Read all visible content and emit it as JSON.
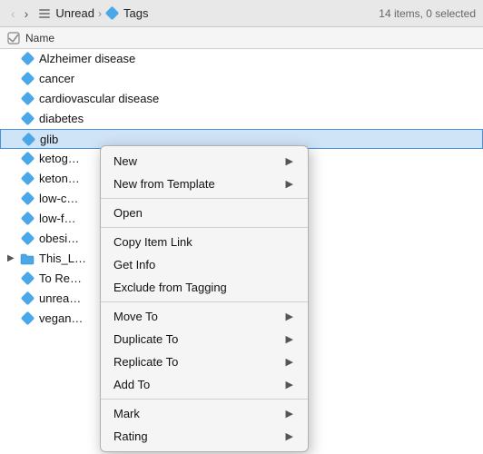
{
  "toolbar": {
    "back_label": "‹",
    "forward_label": "›",
    "breadcrumb": [
      {
        "id": "unread",
        "text": "Unread",
        "icon": "stack"
      },
      {
        "id": "tags",
        "text": "Tags",
        "icon": "tag"
      }
    ],
    "item_count": "14 items, 0 selected"
  },
  "column_header": {
    "name_label": "Name"
  },
  "files": [
    {
      "id": "alzheimer",
      "name": "Alzheimer disease",
      "icon": "tag",
      "indent": 0,
      "expand": false
    },
    {
      "id": "cancer",
      "name": "cancer",
      "icon": "tag",
      "indent": 0,
      "expand": false
    },
    {
      "id": "cardiovascular",
      "name": "cardiovascular disease",
      "icon": "tag",
      "indent": 0,
      "expand": false
    },
    {
      "id": "diabetes",
      "name": "diabetes",
      "icon": "tag",
      "indent": 0,
      "expand": false
    },
    {
      "id": "glib",
      "name": "glib",
      "icon": "tag",
      "indent": 0,
      "expand": false,
      "selected": true
    },
    {
      "id": "ketog",
      "name": "ketog…",
      "icon": "tag",
      "indent": 0,
      "expand": false
    },
    {
      "id": "keton",
      "name": "keton…",
      "icon": "tag",
      "indent": 0,
      "expand": false
    },
    {
      "id": "low-c",
      "name": "low-c…",
      "icon": "tag",
      "indent": 0,
      "expand": false
    },
    {
      "id": "low-f",
      "name": "low-f…",
      "icon": "tag",
      "indent": 0,
      "expand": false
    },
    {
      "id": "obesi",
      "name": "obesi…",
      "icon": "tag",
      "indent": 0,
      "expand": false
    },
    {
      "id": "this_l",
      "name": "This_L…",
      "icon": "folder",
      "indent": 0,
      "expand": true
    },
    {
      "id": "to-re",
      "name": "To Re…",
      "icon": "tag",
      "indent": 0,
      "expand": false
    },
    {
      "id": "unrea",
      "name": "unrea…",
      "icon": "tag",
      "indent": 0,
      "expand": false
    },
    {
      "id": "vegan",
      "name": "vegan…",
      "icon": "tag",
      "indent": 0,
      "expand": false
    }
  ],
  "context_menu": {
    "items": [
      {
        "id": "new",
        "label": "New",
        "has_submenu": true
      },
      {
        "id": "new-from-template",
        "label": "New from Template",
        "has_submenu": true
      },
      {
        "id": "sep1",
        "type": "separator"
      },
      {
        "id": "open",
        "label": "Open",
        "has_submenu": false
      },
      {
        "id": "sep2",
        "type": "separator"
      },
      {
        "id": "copy-item-link",
        "label": "Copy Item Link",
        "has_submenu": false
      },
      {
        "id": "get-info",
        "label": "Get Info",
        "has_submenu": false
      },
      {
        "id": "exclude-from-tagging",
        "label": "Exclude from Tagging",
        "has_submenu": false
      },
      {
        "id": "sep3",
        "type": "separator"
      },
      {
        "id": "move-to",
        "label": "Move To",
        "has_submenu": true
      },
      {
        "id": "duplicate-to",
        "label": "Duplicate To",
        "has_submenu": true
      },
      {
        "id": "replicate-to",
        "label": "Replicate To",
        "has_submenu": true
      },
      {
        "id": "add-to",
        "label": "Add To",
        "has_submenu": true
      },
      {
        "id": "sep4",
        "type": "separator"
      },
      {
        "id": "mark",
        "label": "Mark",
        "has_submenu": true
      },
      {
        "id": "rating",
        "label": "Rating",
        "has_submenu": true
      }
    ]
  }
}
